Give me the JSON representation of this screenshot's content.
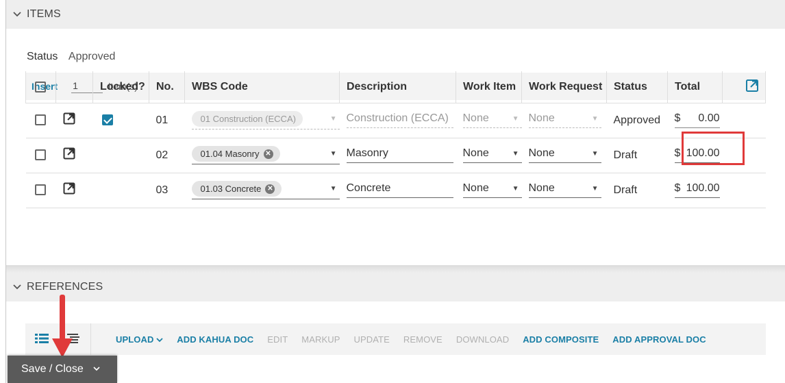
{
  "items_section": {
    "title": "ITEMS",
    "status_label": "Status",
    "status_value": "Approved",
    "insert": {
      "label": "Insert",
      "quantity": "1",
      "unit": "item(s)"
    },
    "columns": [
      "Locked?",
      "No.",
      "WBS Code",
      "Description",
      "Work Item",
      "Work Request",
      "Status",
      "Total"
    ],
    "rows": [
      {
        "locked": true,
        "no": "01",
        "wbs": "01 Construction (ECCA)",
        "description": "Construction (ECCA)",
        "work_item": "None",
        "work_request": "None",
        "status": "Approved",
        "currency": "$",
        "total": "0.00",
        "editable": false
      },
      {
        "locked": false,
        "no": "02",
        "wbs": "01.04 Masonry",
        "description": "Masonry",
        "work_item": "None",
        "work_request": "None",
        "status": "Draft",
        "currency": "$",
        "total": "100.00",
        "editable": true
      },
      {
        "locked": false,
        "no": "03",
        "wbs": "01.03 Concrete",
        "description": "Concrete",
        "work_item": "None",
        "work_request": "None",
        "status": "Draft",
        "currency": "$",
        "total": "100.00",
        "editable": true
      }
    ]
  },
  "references_section": {
    "title": "REFERENCES",
    "actions": [
      {
        "label": "UPLOAD",
        "enabled": true
      },
      {
        "label": "ADD KAHUA DOC",
        "enabled": true
      },
      {
        "label": "EDIT",
        "enabled": false
      },
      {
        "label": "MARKUP",
        "enabled": false
      },
      {
        "label": "UPDATE",
        "enabled": false
      },
      {
        "label": "REMOVE",
        "enabled": false
      },
      {
        "label": "DOWNLOAD",
        "enabled": false
      },
      {
        "label": "ADD COMPOSITE",
        "enabled": true
      },
      {
        "label": "ADD APPROVAL DOC",
        "enabled": true
      }
    ]
  },
  "footer": {
    "save_label": "Save / Close"
  },
  "colors": {
    "accent": "#1a7fa6",
    "highlight": "#e03a3a",
    "save_bg": "#5a5a5a"
  }
}
